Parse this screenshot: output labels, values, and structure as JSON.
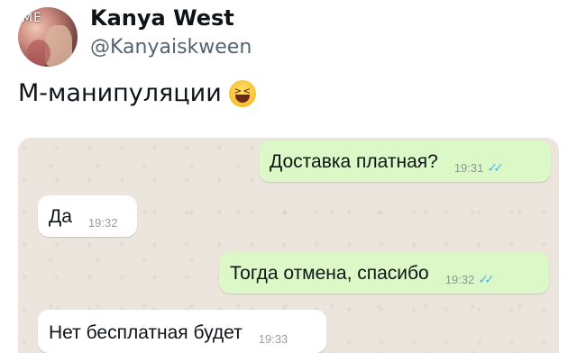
{
  "tweet": {
    "avatar_badge": "ME",
    "name": "Kanya West",
    "handle": "@Kanyaiskween",
    "text": "М-манипуляции",
    "emoji": "grinning-squinting-face"
  },
  "chat": {
    "messages": [
      {
        "direction": "outgoing",
        "text": "Доставка платная?",
        "time": "19:31",
        "status": "read"
      },
      {
        "direction": "incoming",
        "text": "Да",
        "time": "19:32"
      },
      {
        "direction": "outgoing",
        "text": "Тогда отмена, спасибо",
        "time": "19:32",
        "status": "read"
      },
      {
        "direction": "incoming",
        "text": "Нет бесплатная будет",
        "time": "19:33"
      }
    ],
    "colors": {
      "outgoing": "#dcf8c6",
      "incoming": "#ffffff",
      "background": "#ece5dd",
      "read_ticks": "#4fb6ec"
    }
  }
}
